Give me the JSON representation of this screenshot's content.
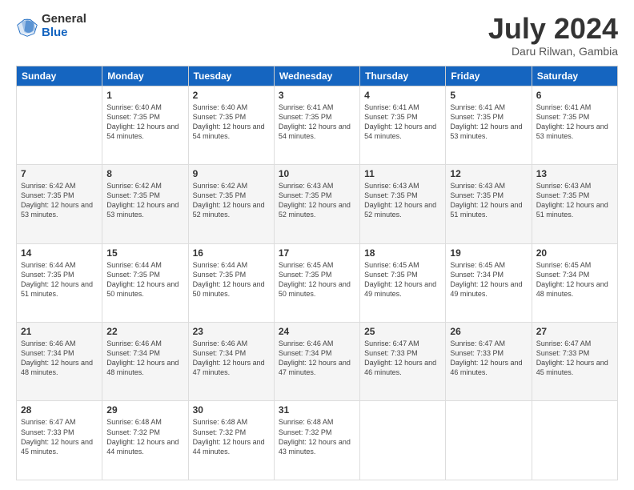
{
  "header": {
    "logo_general": "General",
    "logo_blue": "Blue",
    "month_title": "July 2024",
    "subtitle": "Daru Rilwan, Gambia"
  },
  "days": [
    "Sunday",
    "Monday",
    "Tuesday",
    "Wednesday",
    "Thursday",
    "Friday",
    "Saturday"
  ],
  "weeks": [
    [
      {
        "day": "",
        "sunrise": "",
        "sunset": "",
        "daylight": ""
      },
      {
        "day": "1",
        "sunrise": "Sunrise: 6:40 AM",
        "sunset": "Sunset: 7:35 PM",
        "daylight": "Daylight: 12 hours and 54 minutes."
      },
      {
        "day": "2",
        "sunrise": "Sunrise: 6:40 AM",
        "sunset": "Sunset: 7:35 PM",
        "daylight": "Daylight: 12 hours and 54 minutes."
      },
      {
        "day": "3",
        "sunrise": "Sunrise: 6:41 AM",
        "sunset": "Sunset: 7:35 PM",
        "daylight": "Daylight: 12 hours and 54 minutes."
      },
      {
        "day": "4",
        "sunrise": "Sunrise: 6:41 AM",
        "sunset": "Sunset: 7:35 PM",
        "daylight": "Daylight: 12 hours and 54 minutes."
      },
      {
        "day": "5",
        "sunrise": "Sunrise: 6:41 AM",
        "sunset": "Sunset: 7:35 PM",
        "daylight": "Daylight: 12 hours and 53 minutes."
      },
      {
        "day": "6",
        "sunrise": "Sunrise: 6:41 AM",
        "sunset": "Sunset: 7:35 PM",
        "daylight": "Daylight: 12 hours and 53 minutes."
      }
    ],
    [
      {
        "day": "7",
        "sunrise": "Sunrise: 6:42 AM",
        "sunset": "Sunset: 7:35 PM",
        "daylight": "Daylight: 12 hours and 53 minutes."
      },
      {
        "day": "8",
        "sunrise": "Sunrise: 6:42 AM",
        "sunset": "Sunset: 7:35 PM",
        "daylight": "Daylight: 12 hours and 53 minutes."
      },
      {
        "day": "9",
        "sunrise": "Sunrise: 6:42 AM",
        "sunset": "Sunset: 7:35 PM",
        "daylight": "Daylight: 12 hours and 52 minutes."
      },
      {
        "day": "10",
        "sunrise": "Sunrise: 6:43 AM",
        "sunset": "Sunset: 7:35 PM",
        "daylight": "Daylight: 12 hours and 52 minutes."
      },
      {
        "day": "11",
        "sunrise": "Sunrise: 6:43 AM",
        "sunset": "Sunset: 7:35 PM",
        "daylight": "Daylight: 12 hours and 52 minutes."
      },
      {
        "day": "12",
        "sunrise": "Sunrise: 6:43 AM",
        "sunset": "Sunset: 7:35 PM",
        "daylight": "Daylight: 12 hours and 51 minutes."
      },
      {
        "day": "13",
        "sunrise": "Sunrise: 6:43 AM",
        "sunset": "Sunset: 7:35 PM",
        "daylight": "Daylight: 12 hours and 51 minutes."
      }
    ],
    [
      {
        "day": "14",
        "sunrise": "Sunrise: 6:44 AM",
        "sunset": "Sunset: 7:35 PM",
        "daylight": "Daylight: 12 hours and 51 minutes."
      },
      {
        "day": "15",
        "sunrise": "Sunrise: 6:44 AM",
        "sunset": "Sunset: 7:35 PM",
        "daylight": "Daylight: 12 hours and 50 minutes."
      },
      {
        "day": "16",
        "sunrise": "Sunrise: 6:44 AM",
        "sunset": "Sunset: 7:35 PM",
        "daylight": "Daylight: 12 hours and 50 minutes."
      },
      {
        "day": "17",
        "sunrise": "Sunrise: 6:45 AM",
        "sunset": "Sunset: 7:35 PM",
        "daylight": "Daylight: 12 hours and 50 minutes."
      },
      {
        "day": "18",
        "sunrise": "Sunrise: 6:45 AM",
        "sunset": "Sunset: 7:35 PM",
        "daylight": "Daylight: 12 hours and 49 minutes."
      },
      {
        "day": "19",
        "sunrise": "Sunrise: 6:45 AM",
        "sunset": "Sunset: 7:34 PM",
        "daylight": "Daylight: 12 hours and 49 minutes."
      },
      {
        "day": "20",
        "sunrise": "Sunrise: 6:45 AM",
        "sunset": "Sunset: 7:34 PM",
        "daylight": "Daylight: 12 hours and 48 minutes."
      }
    ],
    [
      {
        "day": "21",
        "sunrise": "Sunrise: 6:46 AM",
        "sunset": "Sunset: 7:34 PM",
        "daylight": "Daylight: 12 hours and 48 minutes."
      },
      {
        "day": "22",
        "sunrise": "Sunrise: 6:46 AM",
        "sunset": "Sunset: 7:34 PM",
        "daylight": "Daylight: 12 hours and 48 minutes."
      },
      {
        "day": "23",
        "sunrise": "Sunrise: 6:46 AM",
        "sunset": "Sunset: 7:34 PM",
        "daylight": "Daylight: 12 hours and 47 minutes."
      },
      {
        "day": "24",
        "sunrise": "Sunrise: 6:46 AM",
        "sunset": "Sunset: 7:34 PM",
        "daylight": "Daylight: 12 hours and 47 minutes."
      },
      {
        "day": "25",
        "sunrise": "Sunrise: 6:47 AM",
        "sunset": "Sunset: 7:33 PM",
        "daylight": "Daylight: 12 hours and 46 minutes."
      },
      {
        "day": "26",
        "sunrise": "Sunrise: 6:47 AM",
        "sunset": "Sunset: 7:33 PM",
        "daylight": "Daylight: 12 hours and 46 minutes."
      },
      {
        "day": "27",
        "sunrise": "Sunrise: 6:47 AM",
        "sunset": "Sunset: 7:33 PM",
        "daylight": "Daylight: 12 hours and 45 minutes."
      }
    ],
    [
      {
        "day": "28",
        "sunrise": "Sunrise: 6:47 AM",
        "sunset": "Sunset: 7:33 PM",
        "daylight": "Daylight: 12 hours and 45 minutes."
      },
      {
        "day": "29",
        "sunrise": "Sunrise: 6:48 AM",
        "sunset": "Sunset: 7:32 PM",
        "daylight": "Daylight: 12 hours and 44 minutes."
      },
      {
        "day": "30",
        "sunrise": "Sunrise: 6:48 AM",
        "sunset": "Sunset: 7:32 PM",
        "daylight": "Daylight: 12 hours and 44 minutes."
      },
      {
        "day": "31",
        "sunrise": "Sunrise: 6:48 AM",
        "sunset": "Sunset: 7:32 PM",
        "daylight": "Daylight: 12 hours and 43 minutes."
      },
      {
        "day": "",
        "sunrise": "",
        "sunset": "",
        "daylight": ""
      },
      {
        "day": "",
        "sunrise": "",
        "sunset": "",
        "daylight": ""
      },
      {
        "day": "",
        "sunrise": "",
        "sunset": "",
        "daylight": ""
      }
    ]
  ]
}
